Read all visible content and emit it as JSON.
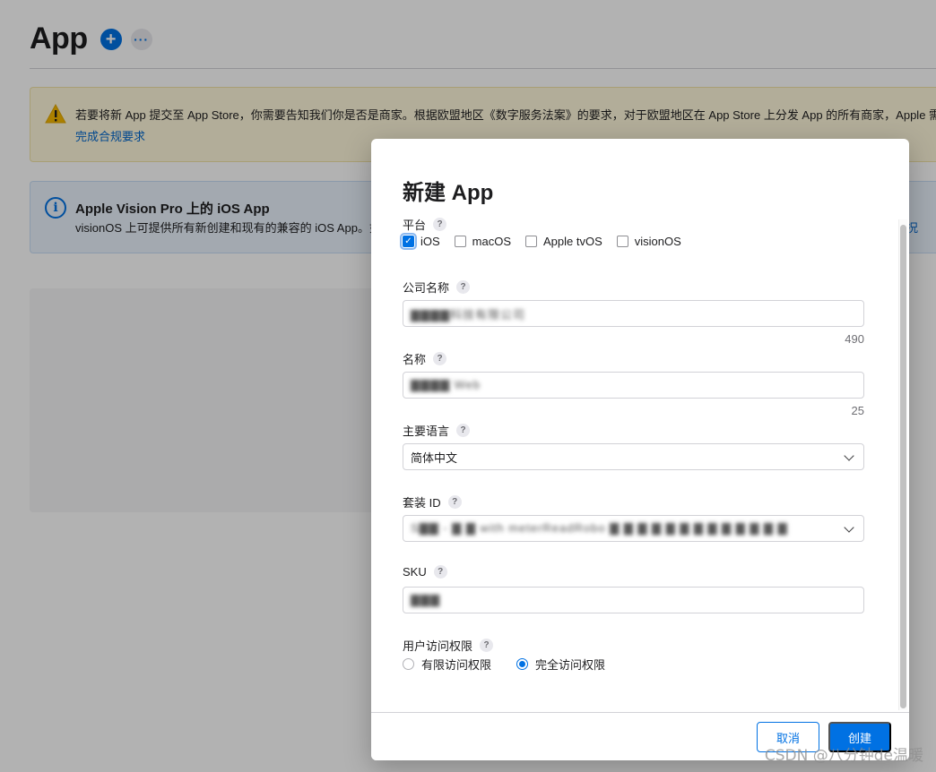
{
  "page": {
    "title": "App",
    "add_symbol": "+",
    "more_symbol": "···"
  },
  "warning_banner": {
    "text": "若要将新 App 提交至 App Store，你需要告知我们你是否是商家。根据欧盟地区《数字服务法案》的要求，对于欧盟地区在 App Store 上分发 App 的所有商家，Apple 需",
    "link": "完成合规要求"
  },
  "info_banner": {
    "title": "Apple Vision Pro 上的 iOS App",
    "text": "visionOS 上可提供所有新创建和现有的兼容的 iOS App。如",
    "link": "况"
  },
  "modal": {
    "title": "新建 App",
    "help_symbol": "?",
    "platform": {
      "label": "平台",
      "options": [
        {
          "label": "iOS",
          "checked": true
        },
        {
          "label": "macOS",
          "checked": false
        },
        {
          "label": "Apple tvOS",
          "checked": false
        },
        {
          "label": "visionOS",
          "checked": false
        }
      ]
    },
    "company": {
      "label": "公司名称",
      "value": "▇▇▇▇科技有限公司",
      "counter": "490"
    },
    "name": {
      "label": "名称",
      "value": "▇▇▇▇ Web",
      "counter": "25"
    },
    "language": {
      "label": "主要语言",
      "value": "简体中文"
    },
    "bundle": {
      "label": "套装 ID",
      "value": "S▇▇ - ▇ ▇ with meterReadRobo ▇ ▇ ▇ ▇ ▇ ▇ ▇ ▇ ▇ ▇ ▇ ▇ ▇"
    },
    "sku": {
      "label": "SKU",
      "value": "▇▇▇"
    },
    "access": {
      "label": "用户访问权限",
      "options": [
        {
          "label": "有限访问权限",
          "selected": false
        },
        {
          "label": "完全访问权限",
          "selected": true
        }
      ]
    },
    "buttons": {
      "cancel": "取消",
      "create": "创建"
    }
  },
  "watermark": "CSDN @八分钟de温暖",
  "colors": {
    "accent": "#0071e3",
    "warning_bg": "#fff8dc",
    "info_bg": "#eaf3fd"
  }
}
